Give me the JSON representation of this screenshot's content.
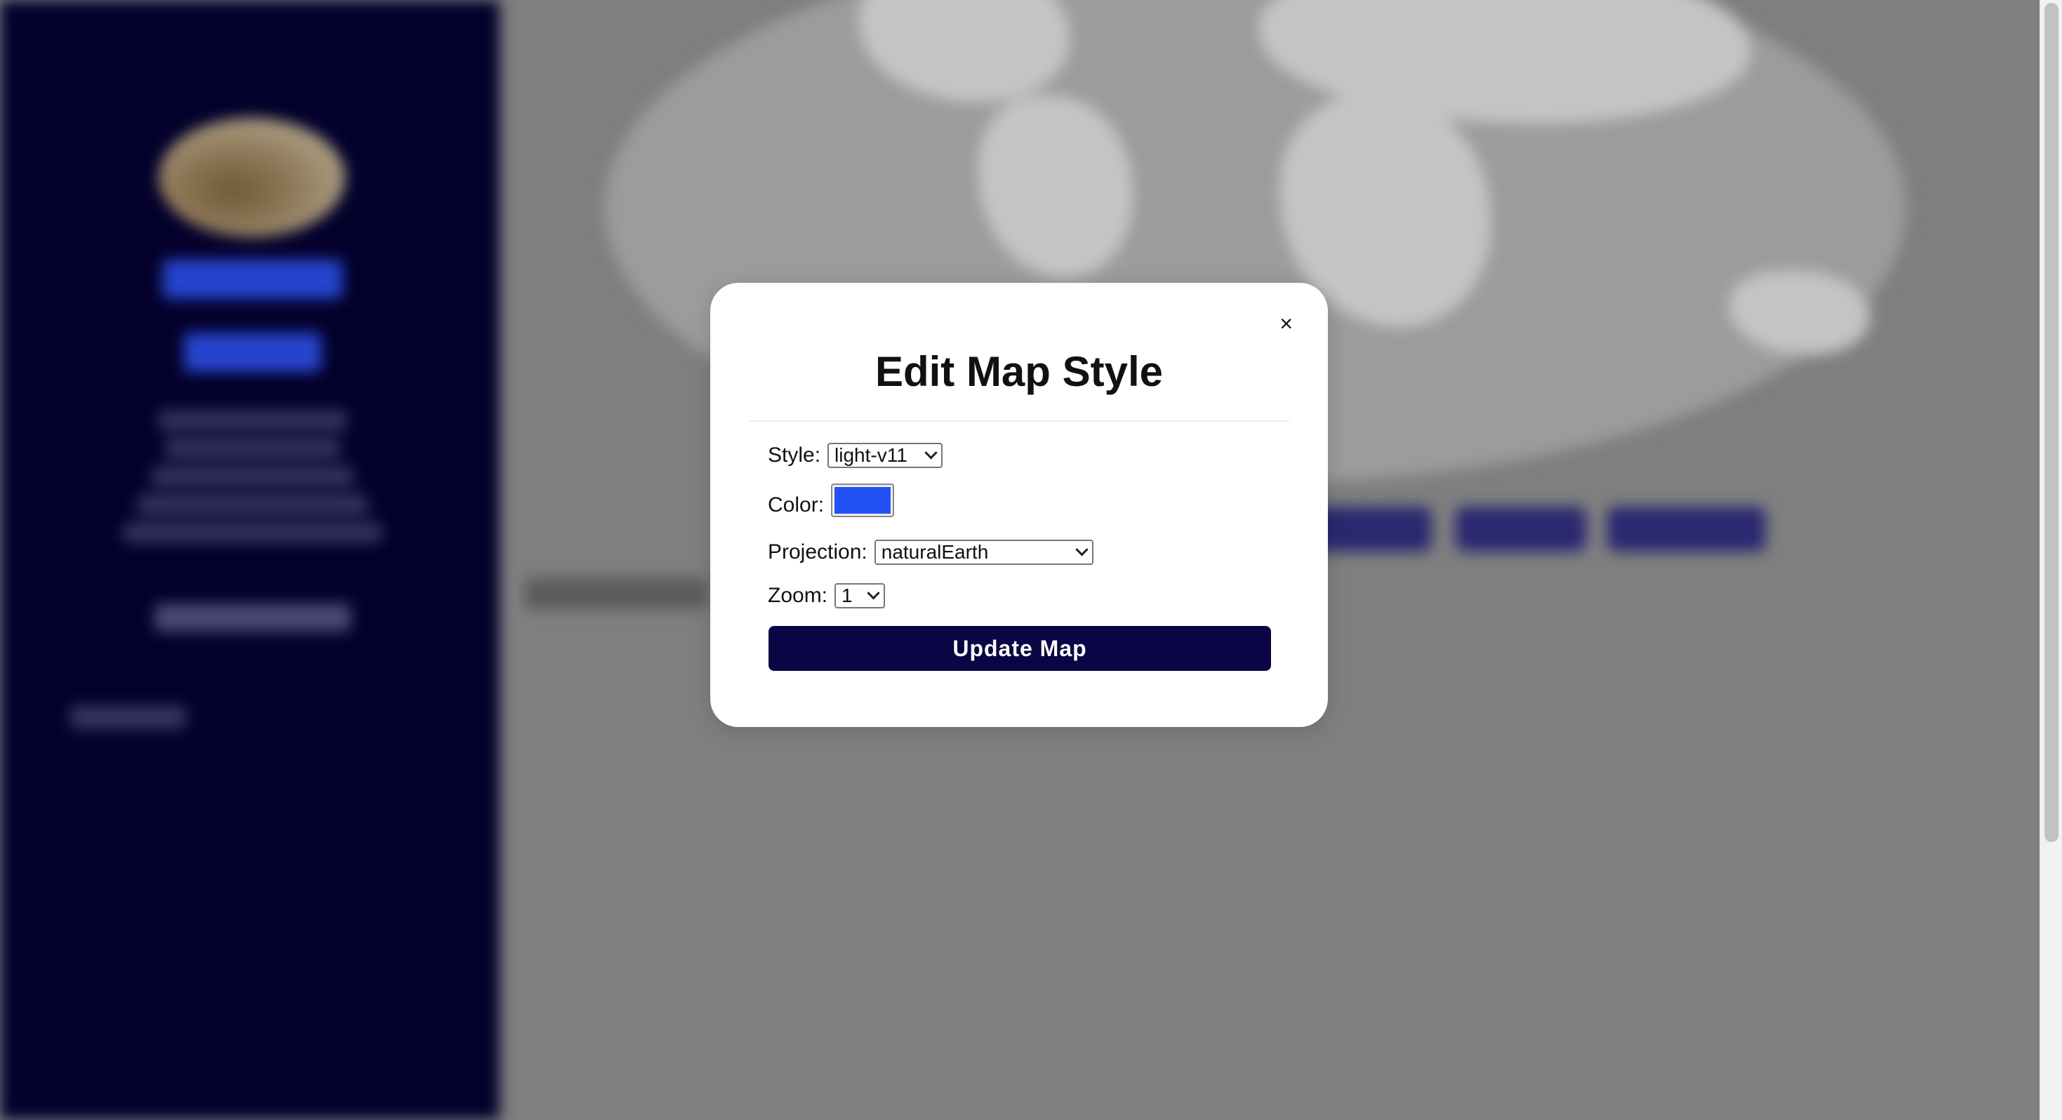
{
  "modal": {
    "close_symbol": "×",
    "title": "Edit Map Style",
    "style": {
      "label": "Style:",
      "value": "light-v11"
    },
    "color": {
      "label": "Color:",
      "value": "#2451f5"
    },
    "projection": {
      "label": "Projection:",
      "value": "naturalEarth"
    },
    "zoom": {
      "label": "Zoom:",
      "value": "1"
    },
    "submit_label": "Update Map"
  },
  "colors": {
    "sidebar_bg": "#03002b",
    "primary_button": "#0b0545",
    "page_overlay": "#7f7f80"
  }
}
